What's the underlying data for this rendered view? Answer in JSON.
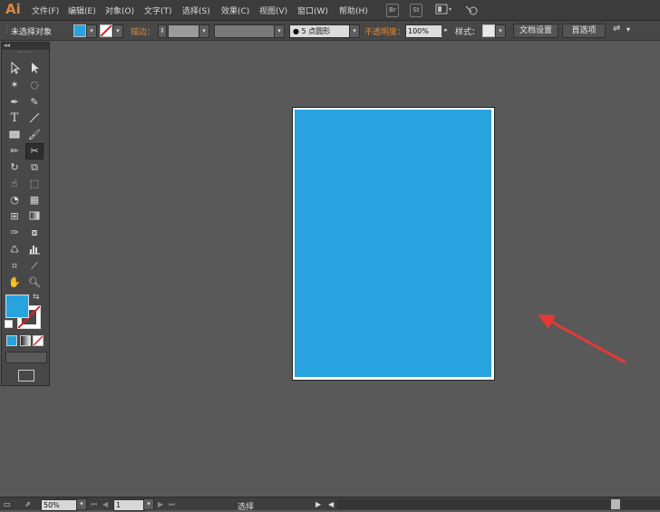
{
  "app": {
    "logo": "Ai"
  },
  "menubar": {
    "items": [
      "文件(F)",
      "编辑(E)",
      "对象(O)",
      "文字(T)",
      "选择(S)",
      "效果(C)",
      "视图(V)",
      "窗口(W)",
      "帮助(H)"
    ],
    "br_label": "Br",
    "st_label": "St"
  },
  "controlbar": {
    "selection_status": "未选择对象",
    "stroke_label": "描边：",
    "brush_value": "5 点圆形",
    "opacity_label": "不透明度：",
    "opacity_value": "100%",
    "style_label": "样式：",
    "doc_setup_button": "文档设置",
    "preferences_button": "首选项"
  },
  "colors": {
    "fill": "#29a3df",
    "artboard": "#ffffff",
    "canvas": "#595959",
    "arrow": "#e53935"
  },
  "statusbar": {
    "zoom": "50%",
    "artboard_number": "1",
    "tool_status": "选择"
  },
  "tools": [
    "selection-tool",
    "direct-selection-tool",
    "magic-wand-tool",
    "lasso-tool",
    "pen-tool",
    "curvature-tool",
    "type-tool",
    "line-tool",
    "rectangle-tool",
    "paintbrush-tool",
    "pencil-tool",
    "scissors-tool",
    "rotate-tool",
    "scale-tool",
    "warp-tool",
    "free-transform-tool",
    "shape-builder-tool",
    "perspective-grid-tool",
    "mesh-tool",
    "gradient-tool",
    "eyedropper-tool",
    "blend-tool",
    "symbol-sprayer-tool",
    "column-graph-tool",
    "artboard-tool",
    "slice-tool",
    "hand-tool",
    "zoom-tool"
  ]
}
